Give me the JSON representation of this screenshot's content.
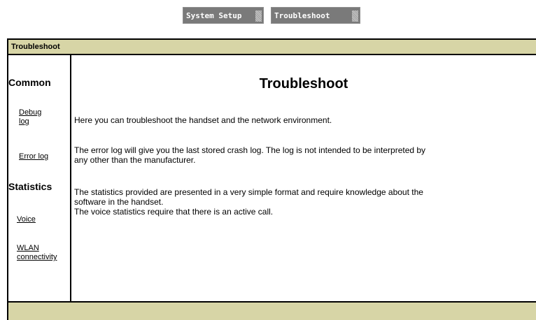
{
  "topnav": {
    "system_setup_label": "System Setup",
    "troubleshoot_label": "Troubleshoot"
  },
  "header": {
    "title": "Troubleshoot"
  },
  "sidebar": {
    "common_heading": "Common",
    "debug_log_line1": "Debug",
    "debug_log_line2": "log",
    "error_log_label": "Error log",
    "statistics_heading": "Statistics",
    "voice_label": "Voice",
    "wlan_line1": "WLAN",
    "wlan_line2": "connectivity"
  },
  "main": {
    "title": "Troubleshoot",
    "intro": "Here you can troubleshoot the handset and the network environment.",
    "error_log_text_line1": "The error log will give you the last stored crash log. The log is not intended to be interpreted by",
    "error_log_text_line2": "any other than the manufacturer.",
    "statistics_text_line1": "The statistics provided are presented in a very simple format and require knowledge about the",
    "statistics_text_line2": "software in the handset.",
    "voice_text": "The voice statistics require that there is an active call."
  }
}
